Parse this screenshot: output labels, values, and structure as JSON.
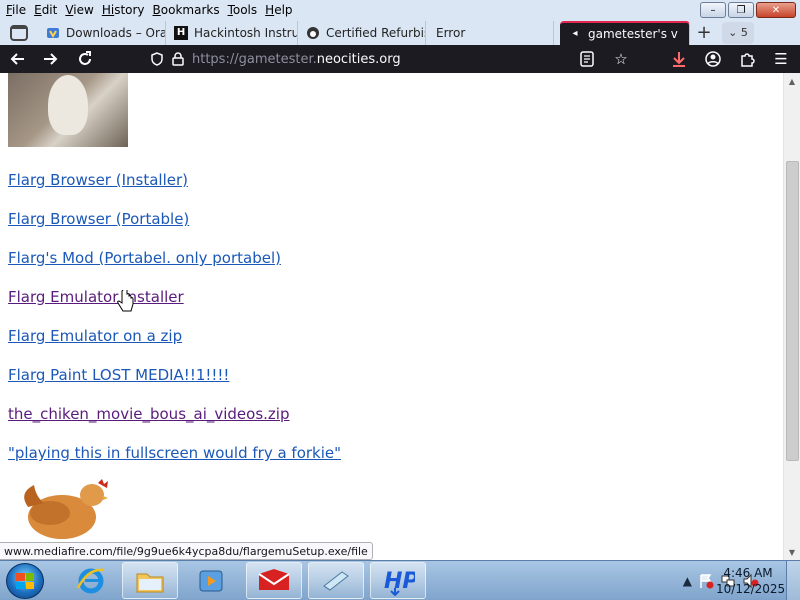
{
  "menu": [
    {
      "ul": "F",
      "rest": "ile"
    },
    {
      "ul": "E",
      "rest": "dit"
    },
    {
      "ul": "V",
      "rest": "iew"
    },
    {
      "ul": "Hi",
      "rest": "story"
    },
    {
      "ul": "B",
      "rest": "ookmarks"
    },
    {
      "ul": "T",
      "rest": "ools"
    },
    {
      "ul": "H",
      "rest": "elp"
    }
  ],
  "window_controls": {
    "minimize": "–",
    "restore": "❐",
    "close": "✕"
  },
  "tabs": [
    {
      "label": "Downloads – Ora",
      "icon": "oracle-favicon"
    },
    {
      "label": "Hackintosh Instru",
      "icon": "h-favicon"
    },
    {
      "label": "Certified Refurbis",
      "icon": "apple-favicon"
    },
    {
      "label": "Error",
      "icon": ""
    },
    {
      "label": "gametester's v",
      "icon": "audio-icon",
      "active": true
    }
  ],
  "tab_close": "✕",
  "new_tab": "+",
  "tab_count": "5",
  "url": {
    "scheme": "https://gametester.",
    "domain": "neocities.org"
  },
  "page": {
    "links": [
      {
        "text": "Flarg Browser (Installer)",
        "visited": false
      },
      {
        "text": "Flarg Browser (Portable)",
        "visited": false
      },
      {
        "text": "Flarg's Mod (Portabel. only portabel)",
        "visited": false
      },
      {
        "text": "Flarg Emulator Installer",
        "visited": true
      },
      {
        "text": "Flarg Emulator on a zip",
        "visited": false
      },
      {
        "text": "Flarg Paint LOST MEDIA!!1!!!!",
        "visited": false
      },
      {
        "text": "the_chiken_movie_bous_ai_videos.zip",
        "visited": true
      },
      {
        "text": "\"playing this in fullscreen would fry a forkie\"",
        "visited": false
      }
    ]
  },
  "status_url": "www.mediafire.com/file/9g9ue6k4ycpa8du/flargemuSetup.exe/file",
  "taskbar": {
    "time": "4:46 AM",
    "date": "10/12/2025"
  },
  "colors": {
    "link": "#1b58b8",
    "visited": "#5a1c7c",
    "chrome_dark": "#1c1b22",
    "active_tab_accent": "#e22850",
    "download_icon": "#ff6a6a"
  }
}
